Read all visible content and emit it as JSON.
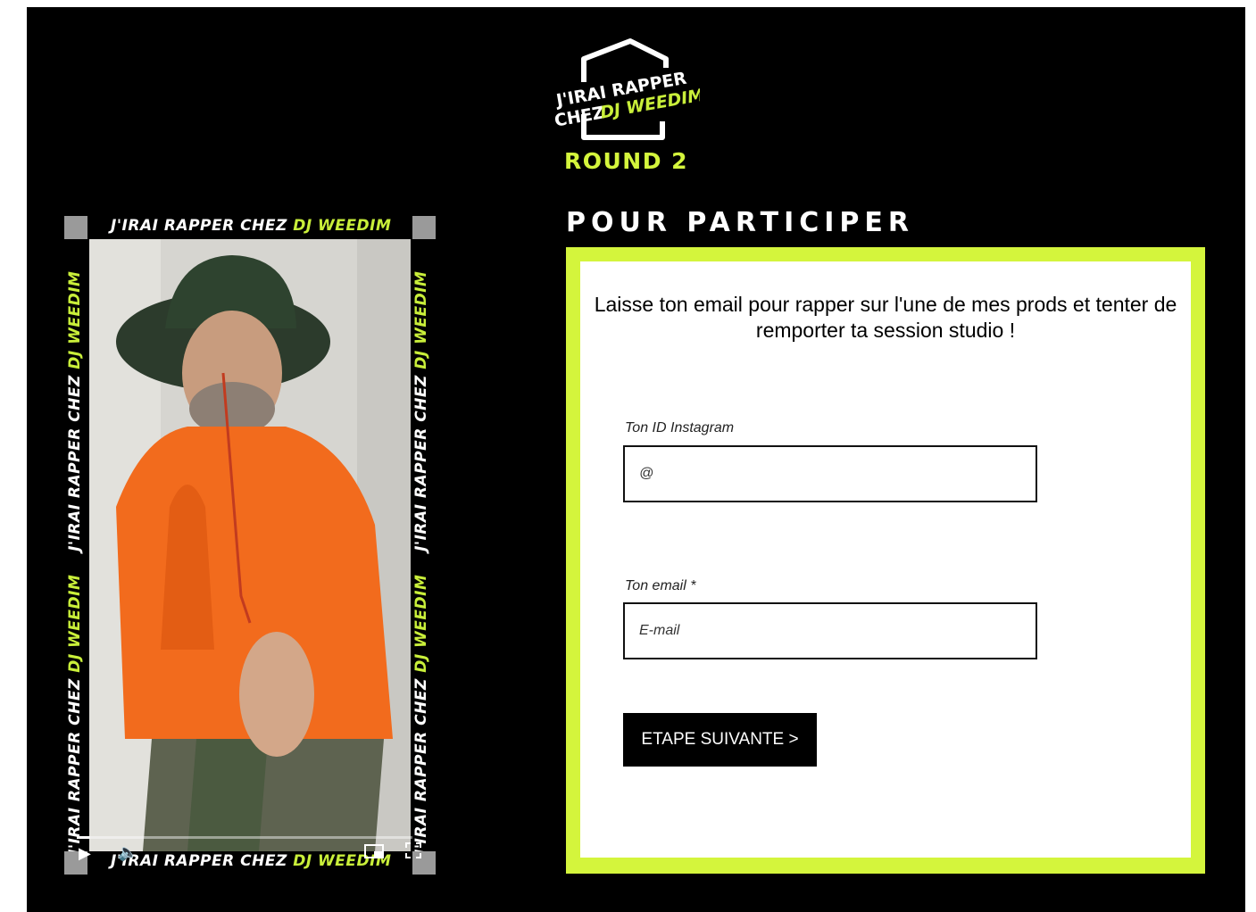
{
  "brand": {
    "line1": "J'IRAI RAPPER",
    "line2_prefix": "CHEZ",
    "line2_highlight": "DJ WEEDIM",
    "accent_color": "#d4f53c"
  },
  "round_label": "ROUND 2",
  "section_title": "POUR PARTICIPER",
  "video": {
    "band_text": "J'IRAI RAPPER CHEZ",
    "band_highlight": "DJ WEEDIM",
    "progress_fraction": 0.04,
    "icons": [
      "play-icon",
      "volume-icon",
      "picture-in-picture-icon",
      "fullscreen-icon"
    ]
  },
  "form": {
    "intro_text": "Laisse ton email pour rapper sur l'une de mes prods et tenter de remporter ta session studio !",
    "instagram_label": "Ton ID Instagram",
    "instagram_placeholder": "@",
    "email_label": "Ton email *",
    "email_placeholder": "E-mail",
    "submit_label": "ETAPE SUIVANTE >"
  }
}
